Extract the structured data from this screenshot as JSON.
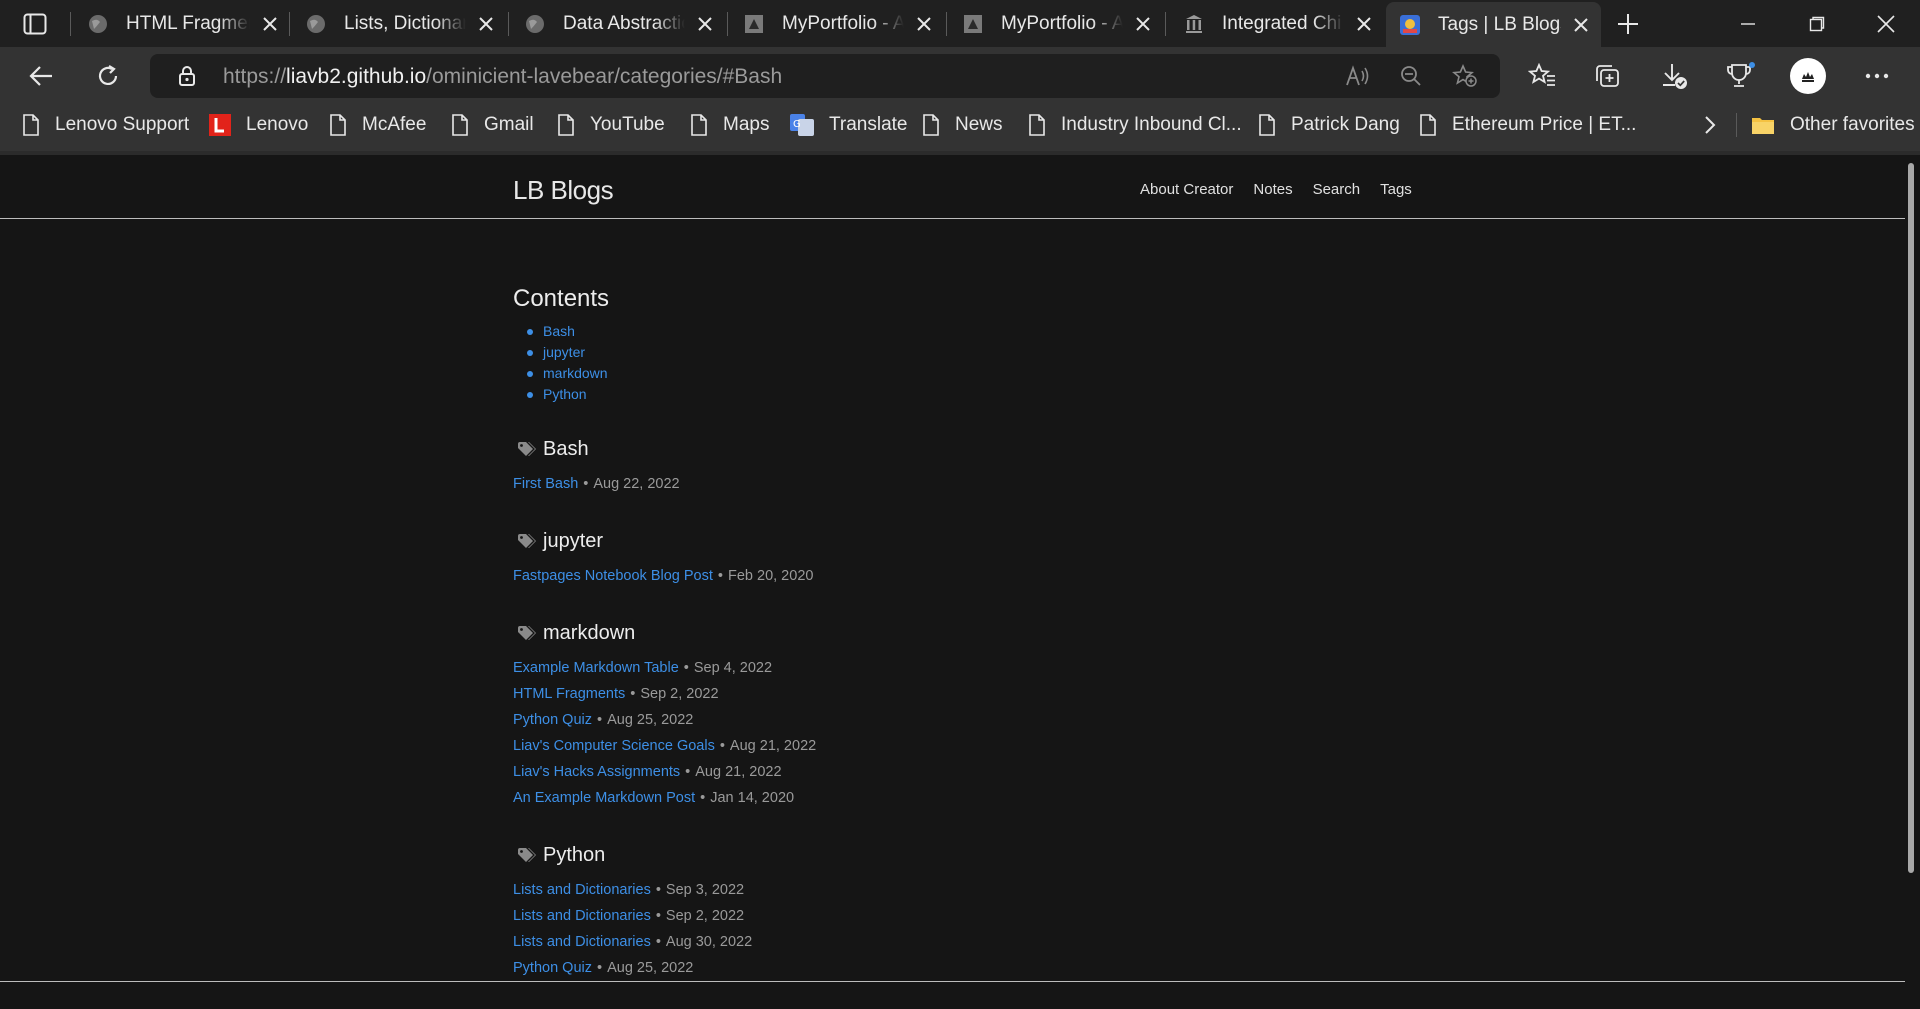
{
  "tabs": [
    {
      "title": "HTML Fragmen",
      "icon": "globe-icon"
    },
    {
      "title": "Lists, Dictionari",
      "icon": "globe-icon"
    },
    {
      "title": "Data Abstractic",
      "icon": "globe-icon"
    },
    {
      "title": "MyPortfolio - A",
      "icon": "triangle-icon"
    },
    {
      "title": "MyPortfolio - A",
      "icon": "triangle-icon"
    },
    {
      "title": "Integrated Chi",
      "icon": "building-icon"
    },
    {
      "title": "Tags | LB Blogs",
      "icon": "site-favicon",
      "active": true
    }
  ],
  "address": {
    "prefix": "https://",
    "host": "liavb2.github.io",
    "path": "/ominicient-lavebear/categories/#Bash"
  },
  "bookmarks": [
    {
      "label": "Lenovo Support",
      "icon": "page-icon"
    },
    {
      "label": "Lenovo",
      "icon": "lenovo-icon"
    },
    {
      "label": "McAfee",
      "icon": "page-icon"
    },
    {
      "label": "Gmail",
      "icon": "page-icon"
    },
    {
      "label": "YouTube",
      "icon": "page-icon"
    },
    {
      "label": "Maps",
      "icon": "page-icon"
    },
    {
      "label": "Translate",
      "icon": "translate-icon"
    },
    {
      "label": "News",
      "icon": "page-icon"
    },
    {
      "label": "Industry Inbound Cl...",
      "icon": "page-icon"
    },
    {
      "label": "Patrick Dang",
      "icon": "page-icon"
    },
    {
      "label": "Ethereum Price | ET...",
      "icon": "page-icon"
    }
  ],
  "other_favorites": "Other favorites",
  "site": {
    "title": "LB Blogs",
    "nav": [
      "About Creator",
      "Notes",
      "Search",
      "Tags"
    ]
  },
  "contents": {
    "heading": "Contents",
    "items": [
      "Bash",
      "jupyter",
      "markdown",
      "Python"
    ]
  },
  "categories": [
    {
      "name": "Bash",
      "posts": [
        {
          "title": "First Bash",
          "date": "Aug 22, 2022"
        }
      ]
    },
    {
      "name": "jupyter",
      "posts": [
        {
          "title": "Fastpages Notebook Blog Post",
          "date": "Feb 20, 2020"
        }
      ]
    },
    {
      "name": "markdown",
      "posts": [
        {
          "title": "Example Markdown Table",
          "date": "Sep 4, 2022"
        },
        {
          "title": "HTML Fragments",
          "date": "Sep 2, 2022"
        },
        {
          "title": "Python Quiz",
          "date": "Aug 25, 2022"
        },
        {
          "title": "Liav's Computer Science Goals",
          "date": "Aug 21, 2022"
        },
        {
          "title": "Liav's Hacks Assignments",
          "date": "Aug 21, 2022"
        },
        {
          "title": "An Example Markdown Post",
          "date": "Jan 14, 2020"
        }
      ]
    },
    {
      "name": "Python",
      "posts": [
        {
          "title": "Lists and Dictionaries",
          "date": "Sep 3, 2022"
        },
        {
          "title": "Lists and Dictionaries",
          "date": "Sep 2, 2022"
        },
        {
          "title": "Lists and Dictionaries",
          "date": "Aug 30, 2022"
        },
        {
          "title": "Python Quiz",
          "date": "Aug 25, 2022"
        }
      ]
    }
  ],
  "separator": "•",
  "colors": {
    "link": "#3d8fe6",
    "page_bg": "#151515",
    "chrome_bg": "#333333",
    "tabstrip_bg": "#202020",
    "lenovo_red": "#e2231a"
  }
}
